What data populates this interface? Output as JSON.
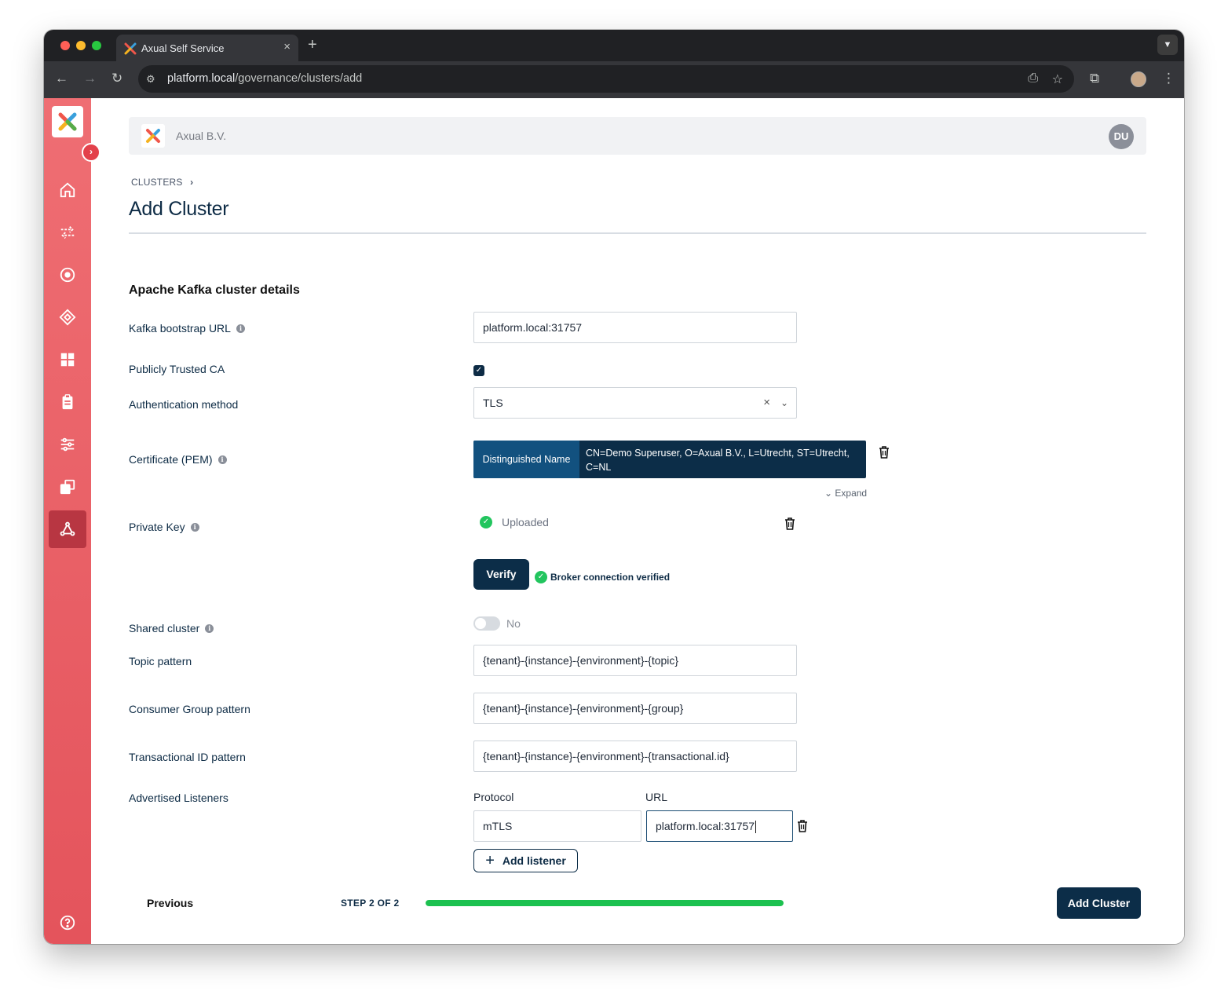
{
  "browser": {
    "tab_title": "Axual Self Service",
    "tab_close": "×",
    "new_tab": "+",
    "url_host": "platform.local",
    "url_path": "/governance/clusters/add"
  },
  "header": {
    "org_name": "Axual B.V.",
    "avatar_initials": "DU"
  },
  "breadcrumb": {
    "label": "CLUSTERS",
    "separator": "›"
  },
  "page": {
    "title": "Add Cluster",
    "section_title": "Apache Kafka cluster details"
  },
  "form": {
    "bootstrap_url": {
      "label": "Kafka bootstrap URL",
      "value": "platform.local:31757"
    },
    "publicly_trusted_ca": {
      "label": "Publicly Trusted CA",
      "checked": true,
      "check_glyph": "✓"
    },
    "auth_method": {
      "label": "Authentication method",
      "value": "TLS",
      "clear_glyph": "×",
      "arrow_glyph": "⌄"
    },
    "certificate": {
      "label": "Certificate (PEM)",
      "dn_tag": "Distinguished Name",
      "dn_value": "CN=Demo Superuser, O=Axual B.V., L=Utrecht, ST=Utrecht, C=NL",
      "expand_label": "⌄ Expand"
    },
    "private_key": {
      "label": "Private Key",
      "status": "Uploaded"
    },
    "verify": {
      "button_label": "Verify",
      "status": "Broker connection verified"
    },
    "shared_cluster": {
      "label": "Shared cluster",
      "value": "No",
      "on": false
    },
    "topic_pattern": {
      "label": "Topic pattern",
      "value": "{tenant}-{instance}-{environment}-{topic}"
    },
    "consumer_group_pattern": {
      "label": "Consumer Group pattern",
      "value": "{tenant}-{instance}-{environment}-{group}"
    },
    "transactional_id_pattern": {
      "label": "Transactional ID pattern",
      "value": "{tenant}-{instance}-{environment}-{transactional.id}"
    },
    "advertised_listeners": {
      "label": "Advertised Listeners",
      "protocol_header": "Protocol",
      "url_header": "URL",
      "rows": [
        {
          "protocol": "mTLS",
          "url": "platform.local:31757"
        }
      ],
      "add_label": "Add listener",
      "add_glyph": "+"
    }
  },
  "footer": {
    "previous_label": "Previous",
    "step_label": "STEP 2 OF 2",
    "progress": 1.0,
    "submit_label": "Add Cluster"
  },
  "info_glyph": "i",
  "check_glyph": "✓",
  "colors": {
    "sidebar": "#e85860",
    "primary": "#0c2d48",
    "success": "#22c55e",
    "progress": "#1cc14f"
  },
  "icons": [
    "home-icon",
    "stream-icon",
    "target-icon",
    "diamond-icon",
    "grid-icon",
    "clipboard-icon",
    "sliders-icon",
    "copy-icon",
    "cluster-icon",
    "help-icon",
    "trash-icon"
  ]
}
